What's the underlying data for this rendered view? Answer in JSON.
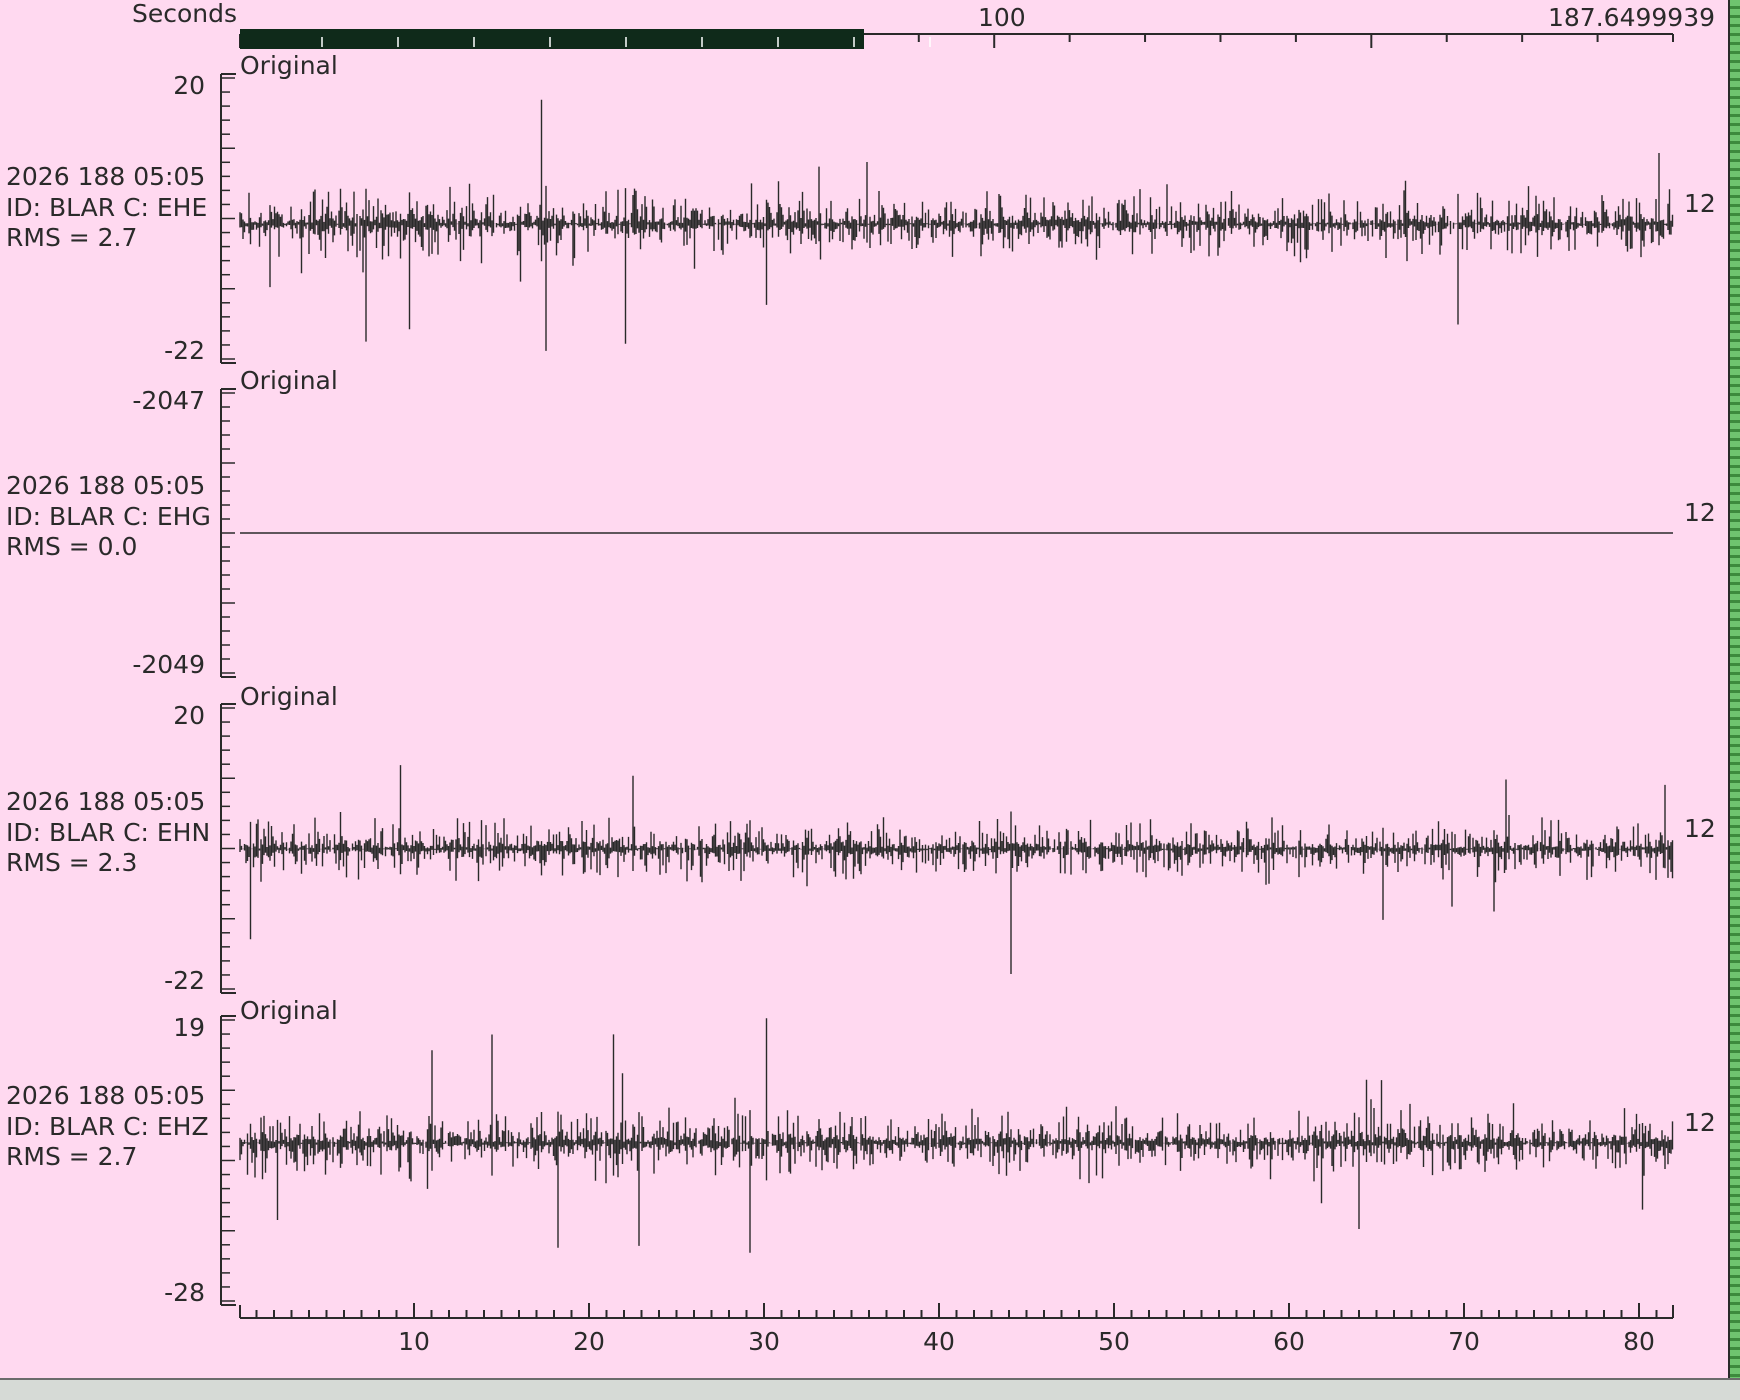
{
  "time_axis": {
    "top_label": "Seconds",
    "top_mid_label": "100",
    "top_end_label": "187.6499939",
    "bottom_ticks": [
      "10",
      "20",
      "30",
      "40",
      "50",
      "60",
      "70",
      "80"
    ]
  },
  "colors": {
    "background": "#ffd9f0",
    "trace": "#2a2a2a",
    "scroll_thumb": "#0f2a1a"
  },
  "channels": [
    {
      "tag": "Original",
      "date": "2026 188 05:05",
      "id": "ID: BLAR C: EHE",
      "rms": "RMS = 2.7",
      "ymax": "20",
      "ymin": "-22",
      "right": "12"
    },
    {
      "tag": "Original",
      "date": "2026 188 05:05",
      "id": "ID: BLAR C: EHG",
      "rms": "RMS = 0.0",
      "ymax": "-2047",
      "ymin": "-2049",
      "right": "12"
    },
    {
      "tag": "Original",
      "date": "2026 188 05:05",
      "id": "ID: BLAR C: EHN",
      "rms": "RMS = 2.3",
      "ymax": "20",
      "ymin": "-22",
      "right": "12"
    },
    {
      "tag": "Original",
      "date": "2026 188 05:05",
      "id": "ID: BLAR C: EHZ",
      "rms": "RMS = 2.7",
      "ymax": "19",
      "ymin": "-28",
      "right": "12"
    }
  ]
}
